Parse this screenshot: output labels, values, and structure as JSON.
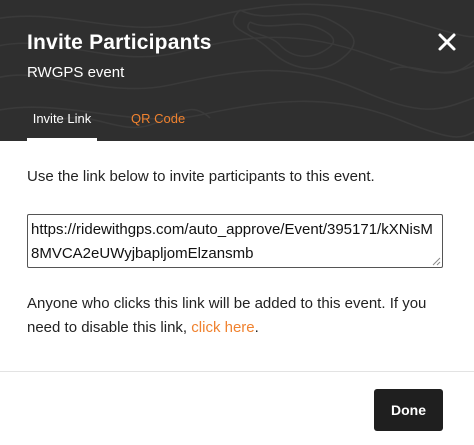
{
  "header": {
    "title": "Invite Participants",
    "subtitle": "RWGPS event",
    "close_icon": "close-icon"
  },
  "tabs": [
    {
      "label": "Invite Link",
      "active": true
    },
    {
      "label": "QR Code",
      "active": false
    }
  ],
  "body": {
    "intro": "Use the link below to invite participants to this event.",
    "invite_url": "https://ridewithgps.com/auto_approve/Event/395171/kXNisM8MVCA2eUWyjbapljomElzansmb",
    "notice_text": "Anyone who clicks this link will be added to this event. If you need to disable this link, ",
    "notice_link": "click here",
    "notice_end": "."
  },
  "footer": {
    "done_label": "Done"
  },
  "colors": {
    "header_bg": "#2f2f2f",
    "accent": "#f0822f",
    "button_bg": "#1f1f1f"
  }
}
